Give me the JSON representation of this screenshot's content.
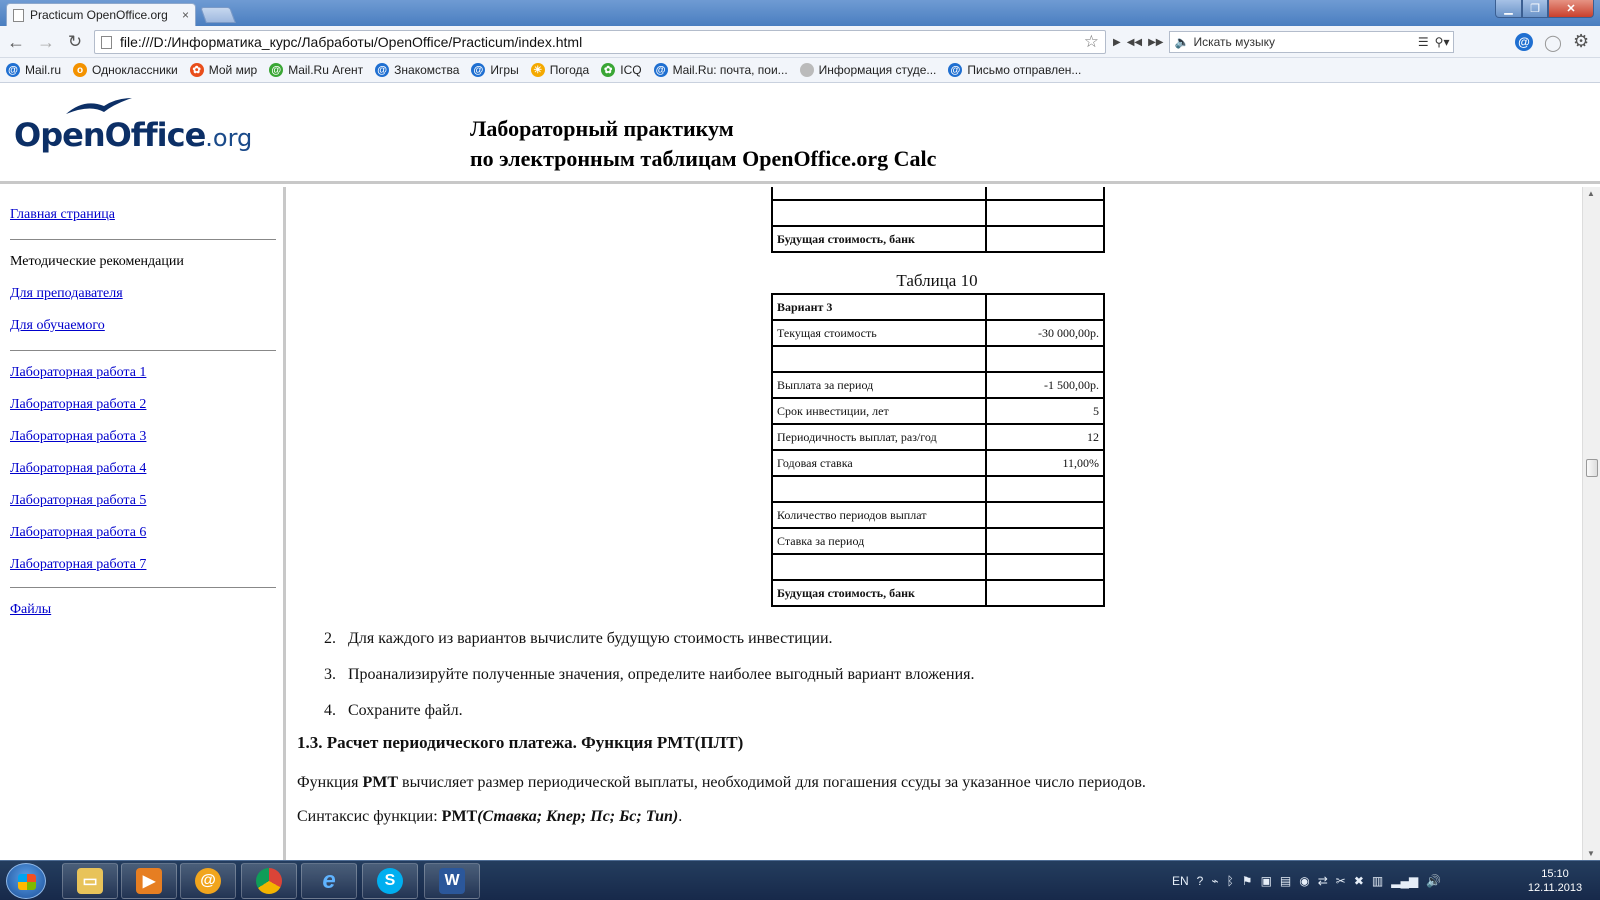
{
  "browser": {
    "tab_title": "Practicum OpenOffice.org",
    "tab_close": "×",
    "url": "file:///D:/Информатика_курс/Лабработы/OpenOffice/Practicum/index.html",
    "music_search_placeholder": "Искать музыку",
    "bookmarks": [
      {
        "label": "Mail.ru",
        "color": "#1f6fd1",
        "icon": "@"
      },
      {
        "label": "Одноклассники",
        "color": "#f39200",
        "icon": "о"
      },
      {
        "label": "Мой мир",
        "color": "#e94e1b",
        "icon": "✿"
      },
      {
        "label": "Mail.Ru Агент",
        "color": "#3aa635",
        "icon": "@"
      },
      {
        "label": "Знакомства",
        "color": "#1f6fd1",
        "icon": "@"
      },
      {
        "label": "Игры",
        "color": "#1f6fd1",
        "icon": "@"
      },
      {
        "label": "Погода",
        "color": "#f4a900",
        "icon": "☀"
      },
      {
        "label": "ICQ",
        "color": "#3aa635",
        "icon": "✿"
      },
      {
        "label": "Mail.Ru: почта, пои...",
        "color": "#1f6fd1",
        "icon": "@"
      },
      {
        "label": "Информация студе...",
        "color": "#bbbbbb",
        "icon": ""
      },
      {
        "label": "Письмо отправлен...",
        "color": "#1f6fd1",
        "icon": "@"
      }
    ]
  },
  "header": {
    "logo_main": "OpenOffice",
    "logo_suffix": ".org",
    "title_line1": "Лабораторный практикум",
    "title_line2": "по электронным таблицам OpenOffice.org Calc"
  },
  "sidebar": {
    "home": "Главная страница",
    "methods": "Методические рекомендации",
    "teacher": "Для преподавателя",
    "student": "Для обучаемого",
    "labs": [
      "Лабораторная работа 1",
      "Лабораторная работа 2",
      "Лабораторная работа 3",
      "Лабораторная работа 4",
      "Лабораторная работа 5",
      "Лабораторная работа 6",
      "Лабораторная работа 7"
    ],
    "files": "Файлы"
  },
  "content": {
    "top_table": {
      "rows": [
        {
          "label": "",
          "value": ""
        },
        {
          "label": "Будущая стоимость, банк",
          "value": ""
        }
      ]
    },
    "table10": {
      "caption": "Таблица 10",
      "rows": [
        {
          "label": "Вариант 3",
          "value": ""
        },
        {
          "label": "Текущая стоимость",
          "value": "-30 000,00р."
        },
        {
          "label": "",
          "value": ""
        },
        {
          "label": "Выплата за период",
          "value": "-1 500,00р."
        },
        {
          "label": "Срок инвестиции, лет",
          "value": "5"
        },
        {
          "label": "Периодичность выплат, раз/год",
          "value": "12"
        },
        {
          "label": "Годовая ставка",
          "value": "11,00%"
        },
        {
          "label": "",
          "value": ""
        },
        {
          "label": "Количество периодов выплат",
          "value": ""
        },
        {
          "label": "Ставка за период",
          "value": ""
        },
        {
          "label": "",
          "value": ""
        },
        {
          "label": "Будущая стоимость, банк",
          "value": ""
        }
      ]
    },
    "steps": [
      {
        "num": "2.",
        "text": "Для каждого из вариантов вычислите будущую стоимость инвестиции."
      },
      {
        "num": "3.",
        "text": "Проанализируйте полученные значения, определите наиболее выгодный вариант вложения."
      },
      {
        "num": "4.",
        "text": "Сохраните файл."
      }
    ],
    "section_heading": "1.3. Расчет периодического платежа. Функция PMT(ПЛТ)",
    "para1_pre": "Функция ",
    "para1_bold": "PMT",
    "para1_post": " вычисляет размер периодической выплаты, необходимой для погашения ссуды за указанное число периодов.",
    "para2_pre": "Синтаксис функции: ",
    "para2_bold": "PMT",
    "para2_bi": "(Ставка; Кпер; Пс; Бс; Тип)",
    "para2_post": "."
  },
  "taskbar": {
    "tray_lang": "EN",
    "time": "15:10",
    "date": "12.11.2013"
  }
}
